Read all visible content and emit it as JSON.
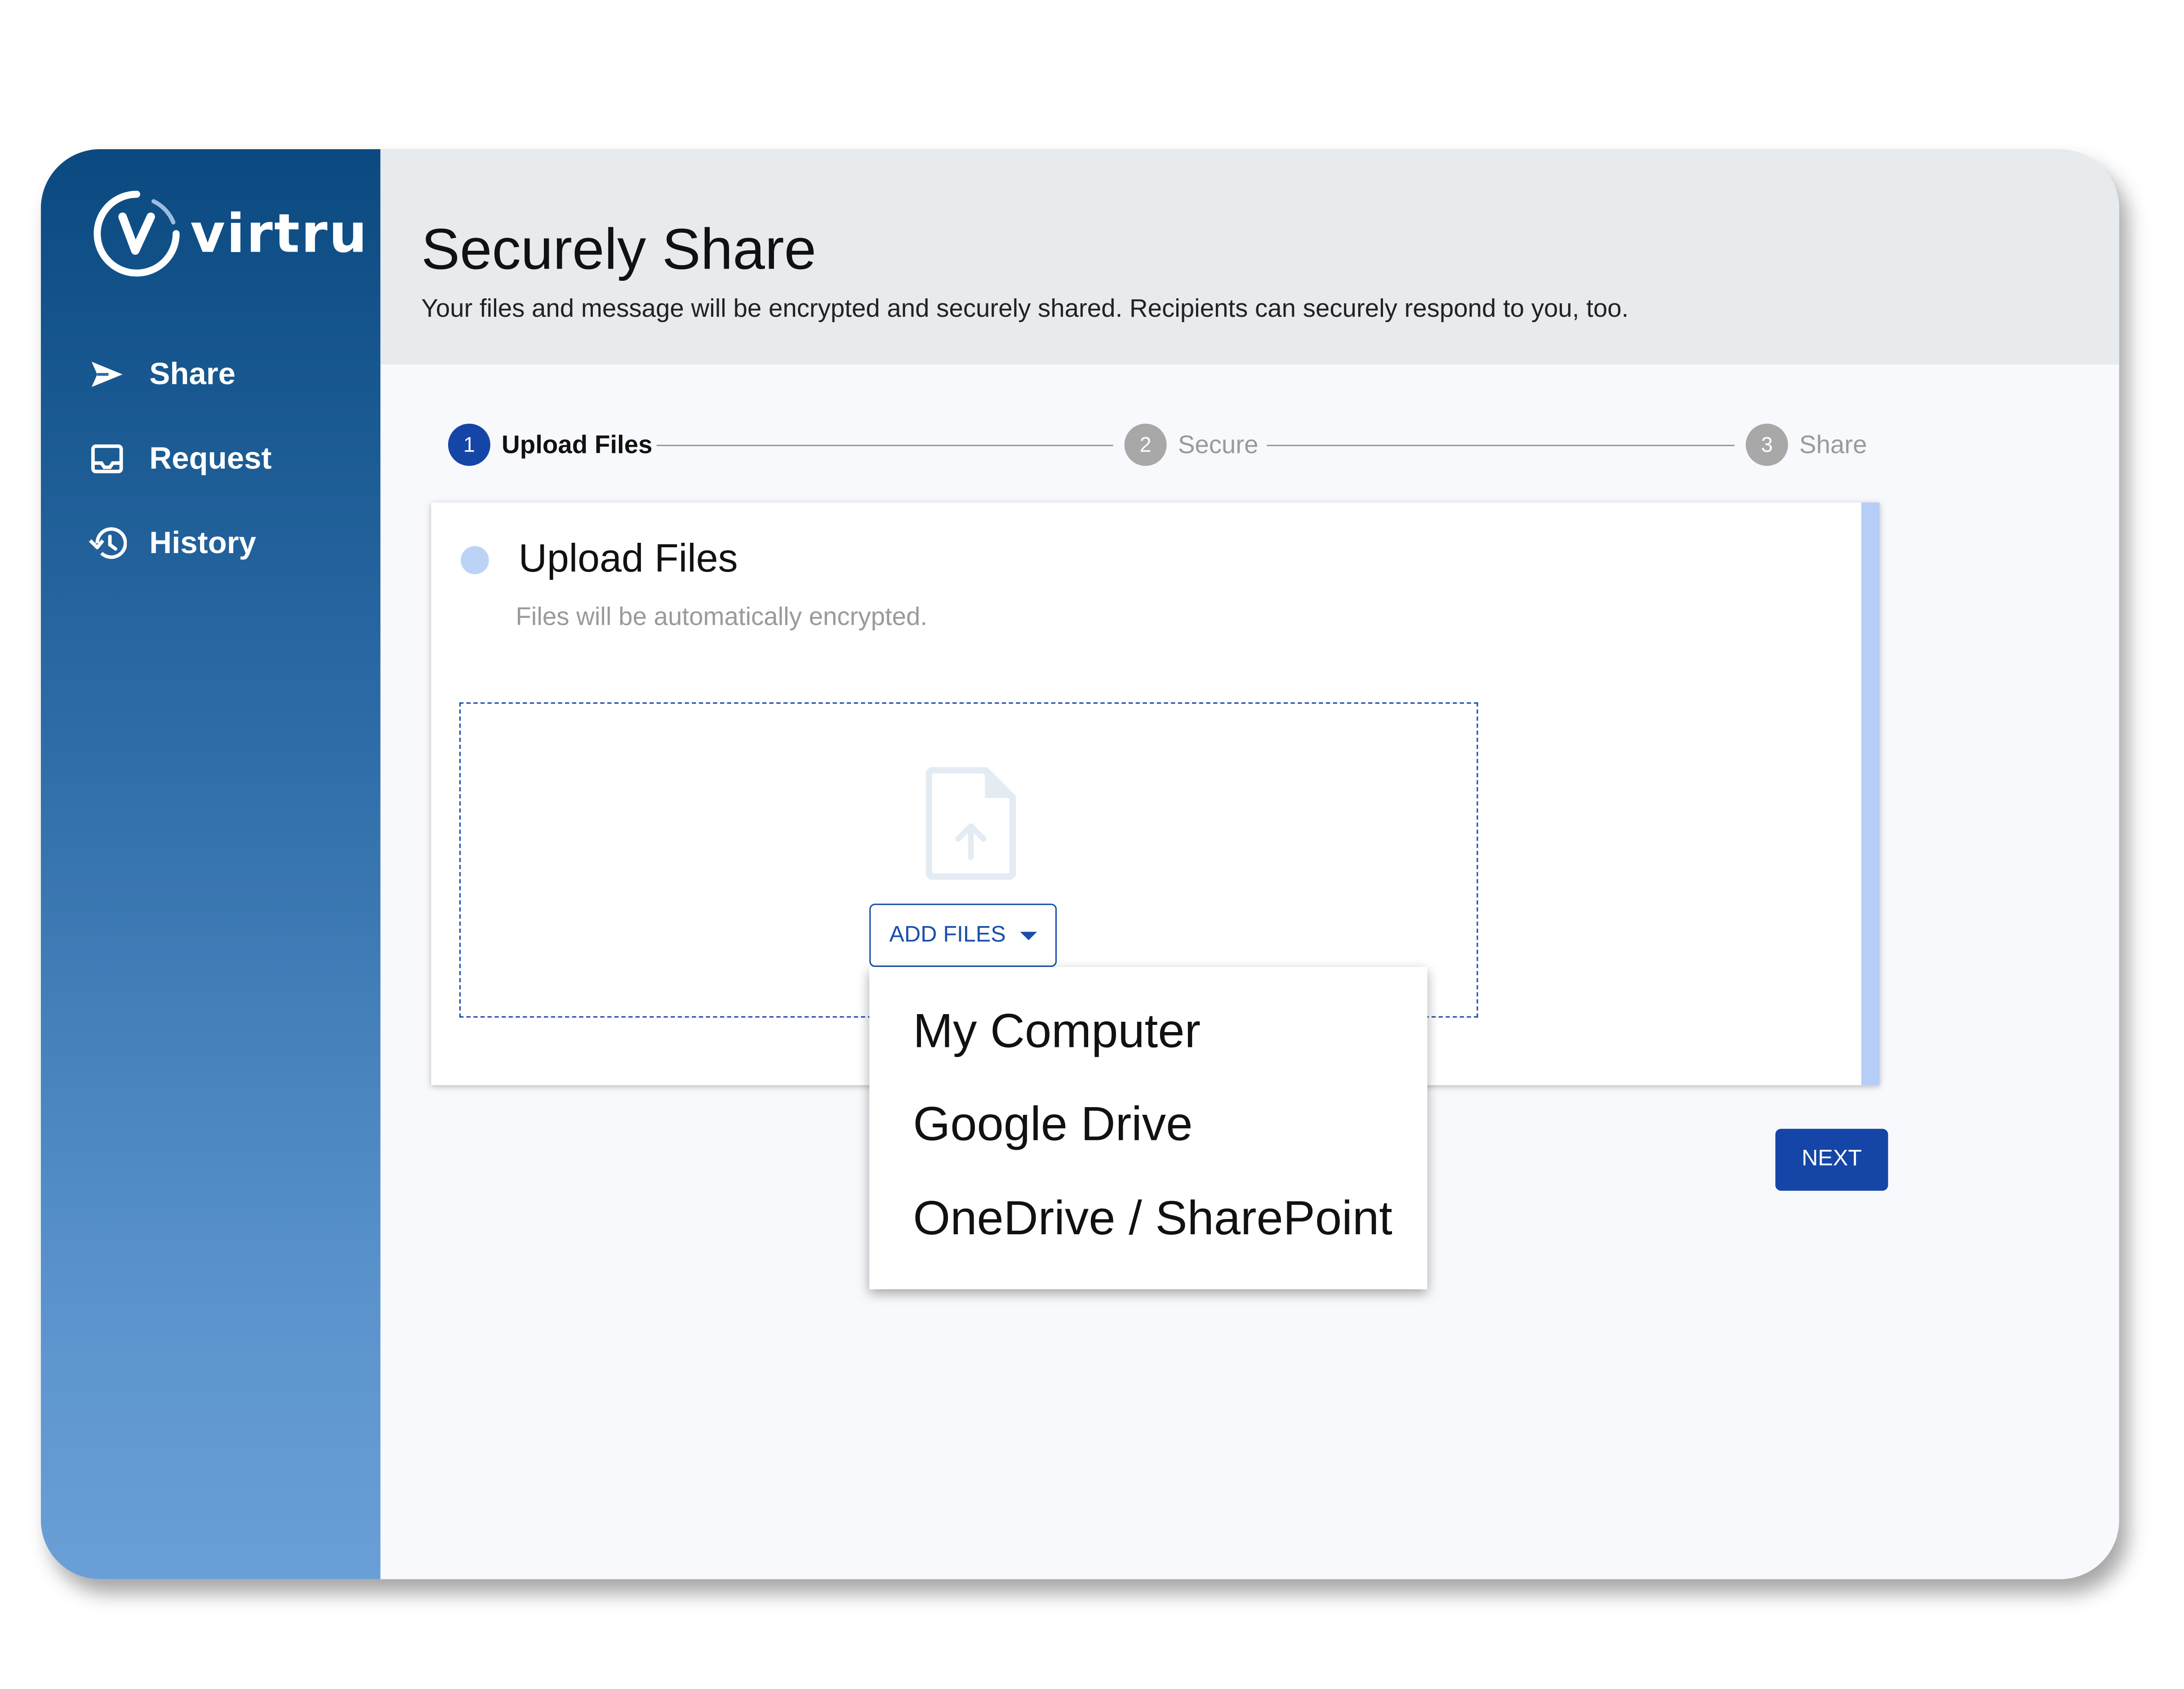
{
  "brand": {
    "name": "virtru"
  },
  "sidebar": {
    "items": [
      {
        "label": "Share",
        "icon": "send-icon"
      },
      {
        "label": "Request",
        "icon": "inbox-icon"
      },
      {
        "label": "History",
        "icon": "history-icon"
      }
    ]
  },
  "header": {
    "title": "Securely Share",
    "subtitle": "Your files and message will be encrypted and securely shared. Recipients can securely respond to you, too."
  },
  "stepper": {
    "steps": [
      {
        "number": "1",
        "label": "Upload Files",
        "state": "active"
      },
      {
        "number": "2",
        "label": "Secure",
        "state": "inactive"
      },
      {
        "number": "3",
        "label": "Share",
        "state": "inactive"
      }
    ]
  },
  "upload_card": {
    "title": "Upload Files",
    "subtitle": "Files will be automatically encrypted.",
    "add_files_label": "ADD FILES"
  },
  "add_files_menu": {
    "options": [
      "My Computer",
      "Google Drive",
      "OneDrive / SharePoint"
    ]
  },
  "actions": {
    "next_label": "NEXT"
  },
  "colors": {
    "primary": "#1546a7",
    "sidebar_top": "#0a4a80",
    "sidebar_bottom": "#6a9fd6",
    "header_bg": "#e7ebee",
    "card_accent": "#b5cdf7"
  }
}
